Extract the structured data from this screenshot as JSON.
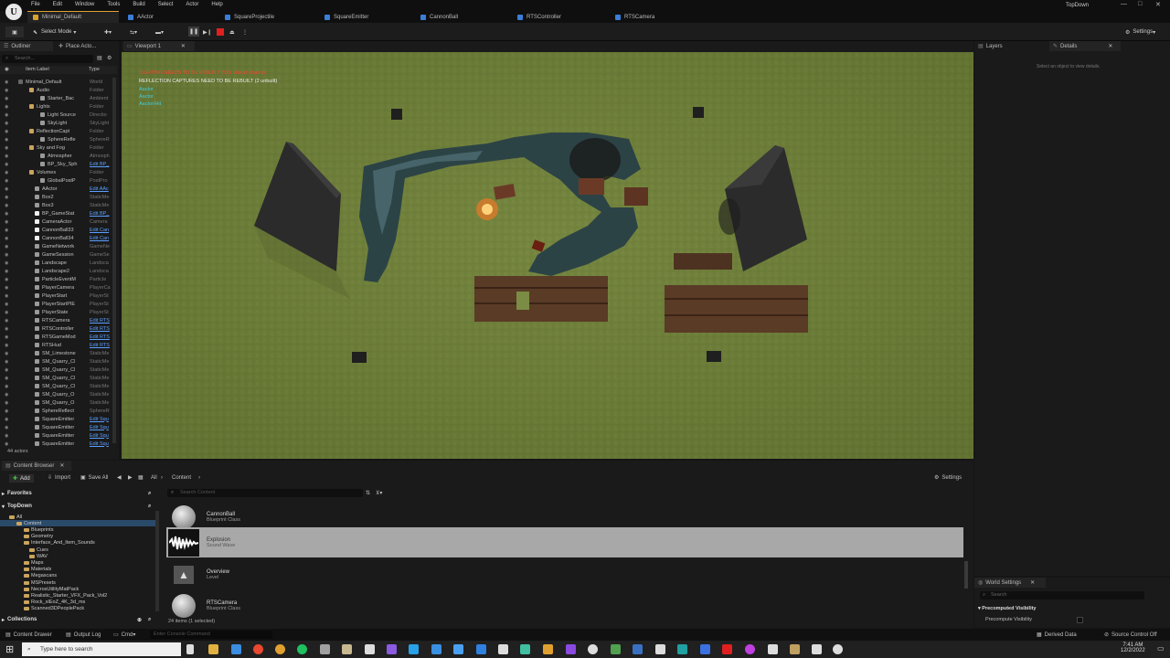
{
  "menu": [
    "File",
    "Edit",
    "Window",
    "Tools",
    "Build",
    "Select",
    "Actor",
    "Help"
  ],
  "project": "Minimal_Default",
  "tabs": [
    "AActor",
    "SquareProjectile",
    "SquareEmitter",
    "CannonBall",
    "RTSController",
    "RTSCamera"
  ],
  "window_title": "TopDown",
  "toolbar": {
    "select_mode": "Select Mode",
    "settings": "Settings"
  },
  "outliner": {
    "tab_outliner": "Outliner",
    "tab_place": "Place Acto...",
    "search_placeholder": "Search...",
    "col_label": "Item Label",
    "col_type": "Type",
    "actor_count": "44 actors",
    "rows": [
      {
        "n": "Minimal_Default",
        "t": "World",
        "i": 28,
        "k": "w"
      },
      {
        "n": "Audio",
        "t": "Folder",
        "i": 40,
        "k": "f"
      },
      {
        "n": "Starter_Bac",
        "t": "Ambient",
        "i": 52,
        "k": "a"
      },
      {
        "n": "Lights",
        "t": "Folder",
        "i": 40,
        "k": "f"
      },
      {
        "n": "Light Source",
        "t": "Directio",
        "i": 52,
        "k": "a"
      },
      {
        "n": "SkyLight",
        "t": "SkyLight",
        "i": 52,
        "k": "a"
      },
      {
        "n": "ReflectionCapt",
        "t": "Folder",
        "i": 40,
        "k": "f"
      },
      {
        "n": "SphereRefle",
        "t": "SphereR",
        "i": 52,
        "k": "a"
      },
      {
        "n": "Sky and Fog",
        "t": "Folder",
        "i": 40,
        "k": "f"
      },
      {
        "n": "Atmospher",
        "t": "Atmosph",
        "i": 52,
        "k": "a"
      },
      {
        "n": "BP_Sky_Sph",
        "t": "Edit BP_",
        "i": 52,
        "k": "a",
        "l": 1
      },
      {
        "n": "Volumes",
        "t": "Folder",
        "i": 40,
        "k": "f"
      },
      {
        "n": "GlobalPostP",
        "t": "PostPro",
        "i": 52,
        "k": "a"
      },
      {
        "n": "AActor",
        "t": "Edit AAc",
        "i": 46,
        "k": "a",
        "l": 1
      },
      {
        "n": "Box2",
        "t": "StaticMe",
        "i": 46,
        "k": "a"
      },
      {
        "n": "Box3",
        "t": "StaticMe",
        "i": 46,
        "k": "a"
      },
      {
        "n": "BP_GameStat",
        "t": "Edit BP_",
        "i": 46,
        "k": "b",
        "l": 1
      },
      {
        "n": "CameraActor",
        "t": "Camera",
        "i": 46,
        "k": "b"
      },
      {
        "n": "CannonBall33",
        "t": "Edit Can",
        "i": 46,
        "k": "b",
        "l": 1
      },
      {
        "n": "CannonBall34",
        "t": "Edit Can",
        "i": 46,
        "k": "b",
        "l": 1
      },
      {
        "n": "GameNetwork",
        "t": "GameNe",
        "i": 46,
        "k": "a"
      },
      {
        "n": "GameSession",
        "t": "GameSe",
        "i": 46,
        "k": "a"
      },
      {
        "n": "Landscape",
        "t": "Landsca",
        "i": 46,
        "k": "a"
      },
      {
        "n": "Landscape2",
        "t": "Landsca",
        "i": 46,
        "k": "a"
      },
      {
        "n": "ParticleEventM",
        "t": "Particle",
        "i": 46,
        "k": "a"
      },
      {
        "n": "PlayerCamera",
        "t": "PlayerCa",
        "i": 46,
        "k": "a"
      },
      {
        "n": "PlayerStart",
        "t": "PlayerSt",
        "i": 46,
        "k": "a"
      },
      {
        "n": "PlayerStartPIE",
        "t": "PlayerSt",
        "i": 46,
        "k": "a"
      },
      {
        "n": "PlayerState",
        "t": "PlayerSt",
        "i": 46,
        "k": "a"
      },
      {
        "n": "RTSCamera",
        "t": "Edit RTS",
        "i": 46,
        "k": "a",
        "l": 1
      },
      {
        "n": "RTSController",
        "t": "Edit RTS",
        "i": 46,
        "k": "a",
        "l": 1
      },
      {
        "n": "RTSGameMod",
        "t": "Edit RTS",
        "i": 46,
        "k": "a",
        "l": 1
      },
      {
        "n": "RTSHud",
        "t": "Edit RTS",
        "i": 46,
        "k": "a",
        "l": 1
      },
      {
        "n": "SM_Limestone",
        "t": "StaticMe",
        "i": 46,
        "k": "a"
      },
      {
        "n": "SM_Quarry_Cl",
        "t": "StaticMe",
        "i": 46,
        "k": "a"
      },
      {
        "n": "SM_Quarry_Cl",
        "t": "StaticMe",
        "i": 46,
        "k": "a"
      },
      {
        "n": "SM_Quarry_Cl",
        "t": "StaticMe",
        "i": 46,
        "k": "a"
      },
      {
        "n": "SM_Quarry_Cl",
        "t": "StaticMe",
        "i": 46,
        "k": "a"
      },
      {
        "n": "SM_Quarry_O",
        "t": "StaticMe",
        "i": 46,
        "k": "a"
      },
      {
        "n": "SM_Quarry_O",
        "t": "StaticMe",
        "i": 46,
        "k": "a"
      },
      {
        "n": "SphereReflect",
        "t": "SphereR",
        "i": 46,
        "k": "a"
      },
      {
        "n": "SquareEmitter",
        "t": "Edit Squ",
        "i": 46,
        "k": "a",
        "l": 1
      },
      {
        "n": "SquareEmitter",
        "t": "Edit Squ",
        "i": 46,
        "k": "a",
        "l": 1
      },
      {
        "n": "SquareEmitter",
        "t": "Edit Squ",
        "i": 46,
        "k": "a",
        "l": 1
      },
      {
        "n": "SquareEmitter",
        "t": "Edit Squ",
        "i": 46,
        "k": "a",
        "l": 1
      }
    ]
  },
  "viewport": {
    "tab": "Viewport 1",
    "warn1": "LIGHTING NEEDS TO BE REBUILT (519 unbuilt objects)",
    "warn2": "REFLECTION CAPTURES NEED TO BE REBUILT (2 unbuilt)",
    "stat1": "Aactor",
    "stat2": "Aactor",
    "stat3": "Aactor/Hit"
  },
  "layers": {
    "tab_layers": "Layers",
    "tab_details": "Details",
    "hint": "Select an object to view details."
  },
  "world": {
    "tab": "World Settings",
    "search": "Search",
    "section": "Precomputed Visibility",
    "row": "Precompute Visibility"
  },
  "content": {
    "tab": "Content Browser",
    "add": "Add",
    "import": "Import",
    "save_all": "Save All",
    "crumb_all": "All",
    "crumb_content": "Content",
    "settings": "Settings",
    "favorites": "Favorites",
    "project": "TopDown",
    "collections": "Collections",
    "search_placeholder": "Search Content",
    "count": "24 items (1 selected)",
    "tree": [
      {
        "n": "All",
        "i": 10
      },
      {
        "n": "Content",
        "i": 18
      },
      {
        "n": "Blueprints",
        "i": 26
      },
      {
        "n": "Geometry",
        "i": 26
      },
      {
        "n": "Interface_And_Item_Sounds",
        "i": 26
      },
      {
        "n": "Cues",
        "i": 32
      },
      {
        "n": "WAV",
        "i": 32
      },
      {
        "n": "Maps",
        "i": 26
      },
      {
        "n": "Materials",
        "i": 26
      },
      {
        "n": "Megascans",
        "i": 26
      },
      {
        "n": "MSPresets",
        "i": 26
      },
      {
        "n": "NecrosUtilityMatPack",
        "i": 26
      },
      {
        "n": "Realistic_Starter_VFX_Pack_Vol2",
        "i": 26
      },
      {
        "n": "Rock_sIEoZ_4K_3d_ms",
        "i": 26
      },
      {
        "n": "Scanned3DPeoplePack",
        "i": 26
      }
    ],
    "assets": [
      {
        "name": "CannonBall",
        "type": "Blueprint Class"
      },
      {
        "name": "Explosion",
        "type": "Sound Wave"
      },
      {
        "name": "Overview",
        "type": "Level"
      },
      {
        "name": "RTSCamera",
        "type": "Blueprint Class"
      }
    ]
  },
  "status": {
    "drawer": "Content Drawer",
    "output": "Output Log",
    "cmd": "Cmd",
    "console": "Enter Console Command",
    "derived": "Derived Data",
    "source": "Source Control Off"
  },
  "taskbar": {
    "search": "Type here to search",
    "time": "7:41 AM",
    "date": "12/2/2022"
  }
}
